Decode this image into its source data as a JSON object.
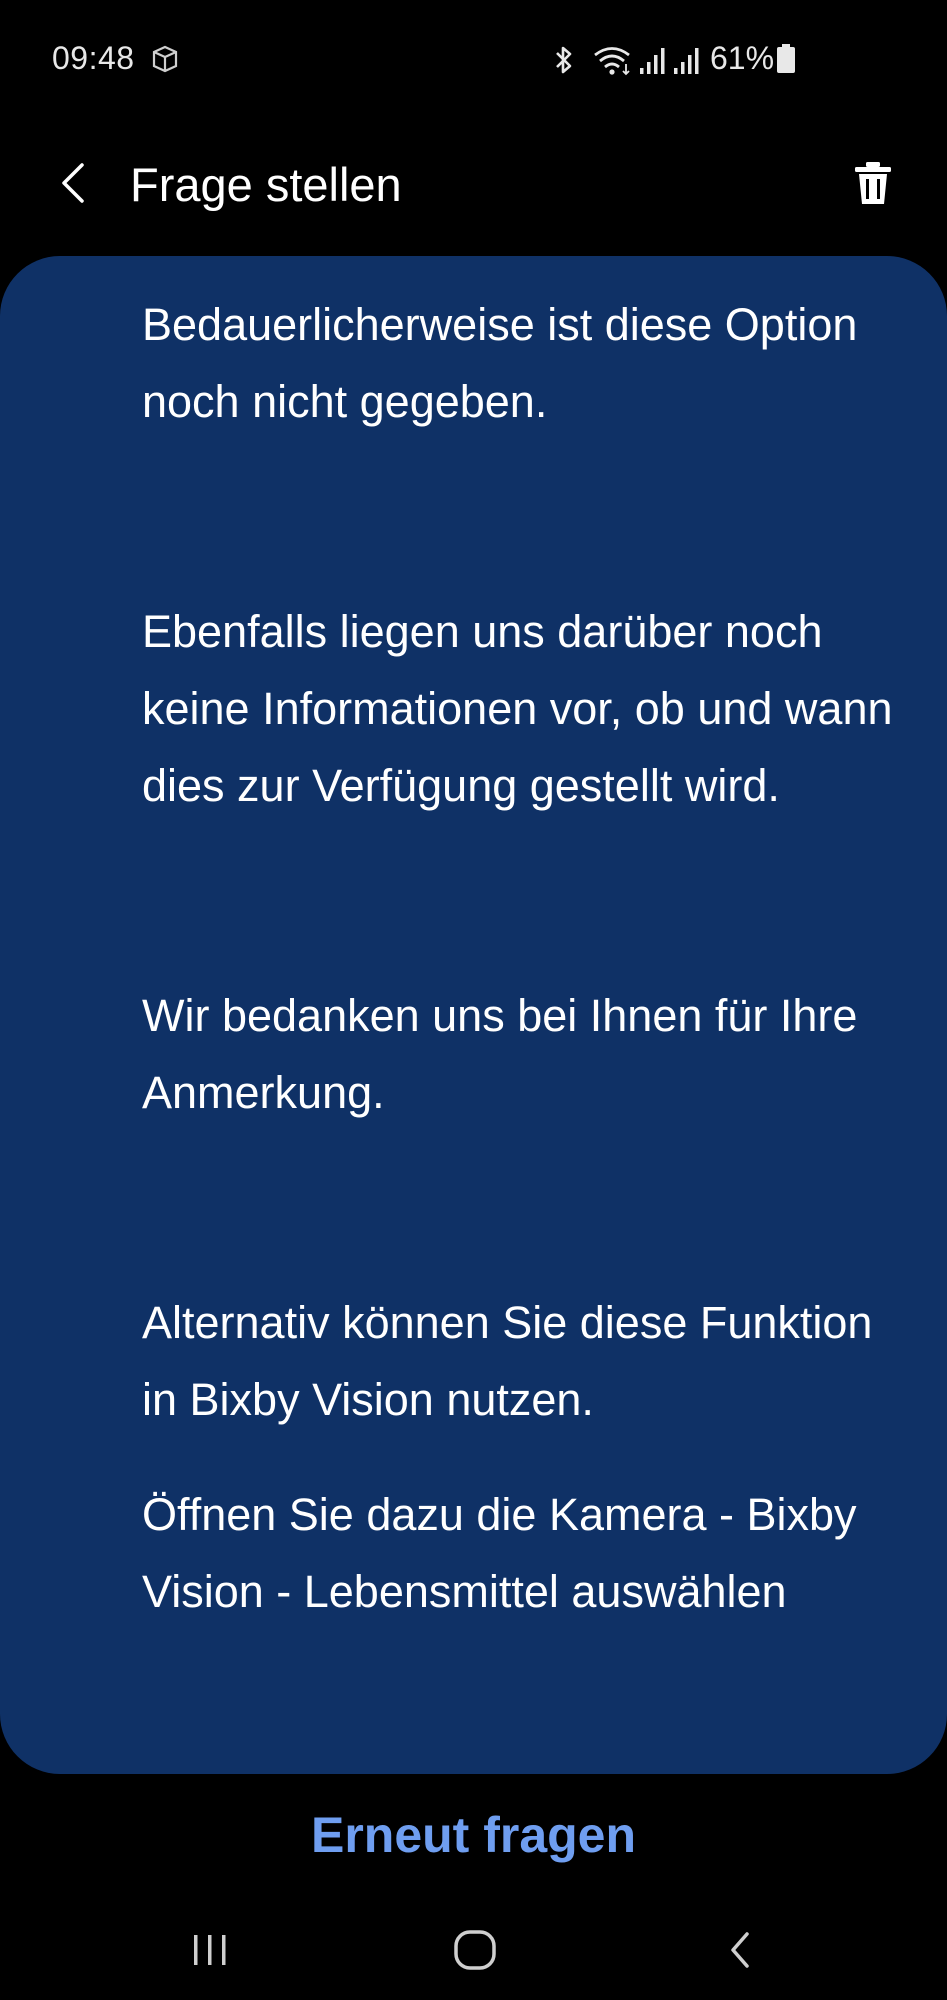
{
  "status_bar": {
    "time": "09:48",
    "battery_percent": "61%",
    "icons": [
      "cube-icon",
      "bluetooth-icon",
      "wifi-icon",
      "signal-icon",
      "signal-icon",
      "battery-icon"
    ]
  },
  "header": {
    "title": "Frage stellen",
    "back_icon": "chevron-left-icon",
    "delete_icon": "trash-icon"
  },
  "answer": {
    "paragraphs": [
      "Bedauerlicherweise ist diese Option noch nicht gegeben.",
      "Ebenfalls liegen uns darüber noch keine Informationen vor, ob und wann dies zur Verfügung gestellt wird.",
      "Wir bedanken uns bei Ihnen für Ihre Anmerkung.",
      "Alternativ können Sie diese Funktion in Bixby Vision nutzen.",
      "Öffnen Sie dazu die Kamera - Bixby Vision - Lebensmittel auswählen"
    ]
  },
  "actions": {
    "ask_again_label": "Erneut fragen"
  },
  "nav_bar": {
    "icons": [
      "recents-icon",
      "home-icon",
      "back-icon"
    ]
  },
  "colors": {
    "background": "#000000",
    "card": "#0f3166",
    "accent": "#6f9ef0",
    "text": "#ffffff"
  }
}
